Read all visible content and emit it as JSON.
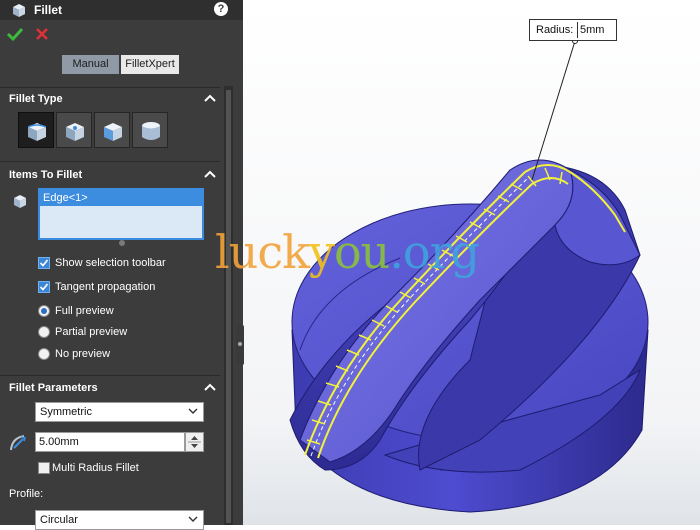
{
  "title": "Fillet",
  "mode_buttons": {
    "manual": "Manual",
    "xpert": "FilletXpert"
  },
  "sections": {
    "fillet_type": "Fillet Type",
    "items": "Items To Fillet",
    "parameters": "Fillet Parameters"
  },
  "items": {
    "selected": "Edge<1>"
  },
  "options": {
    "show_selection_toolbar": "Show selection toolbar",
    "tangent_propagation": "Tangent propagation",
    "full_preview": "Full preview",
    "partial_preview": "Partial preview",
    "no_preview": "No preview"
  },
  "parameters": {
    "method": "Symmetric",
    "radius": "5.00mm",
    "multi_radius": "Multi Radius Fillet",
    "profile_label": "Profile:",
    "profile": "Circular"
  },
  "callout": {
    "label": "Radius:",
    "value": "5mm"
  },
  "watermark": {
    "p1": "luck",
    "p2": "y",
    "p3": "ou",
    "p4": ".org"
  },
  "colors": {
    "panel": "#3c3c3c",
    "model": "#4a48c4",
    "highlight": "#f3f23a",
    "accent": "#3c8ce0"
  }
}
